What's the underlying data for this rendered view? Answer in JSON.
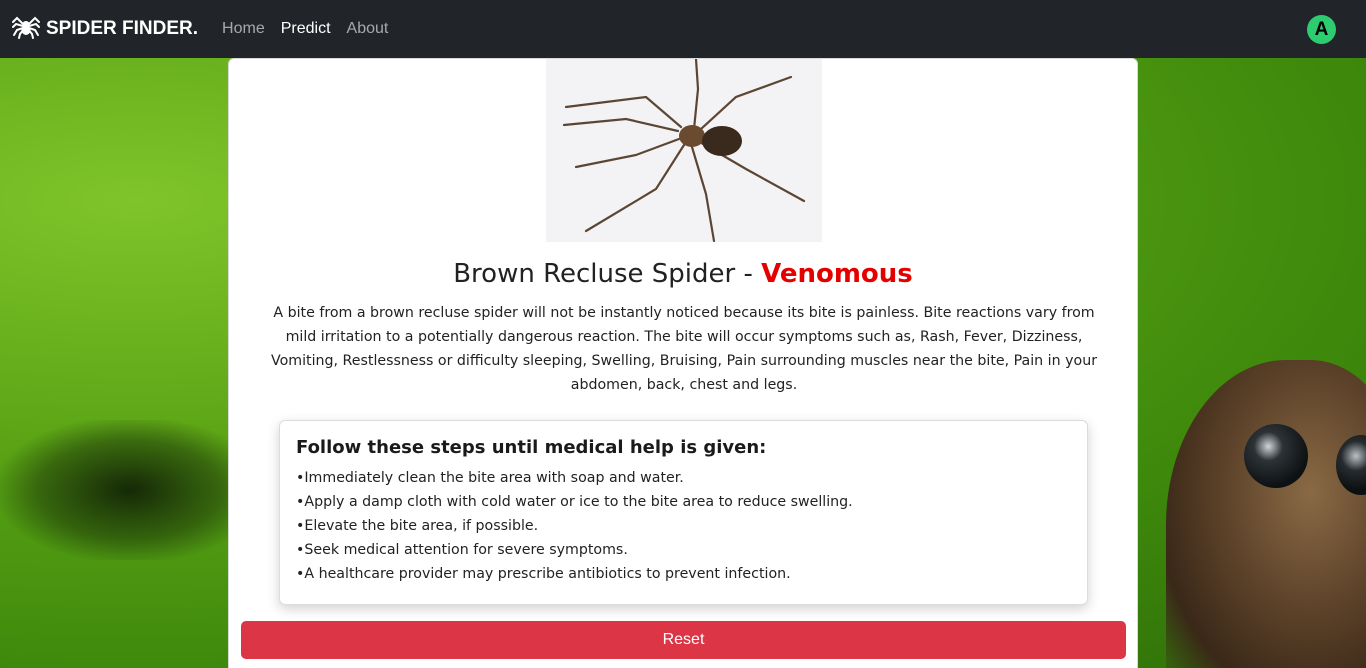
{
  "navbar": {
    "brand": "SPIDER FINDER.",
    "links": [
      "Home",
      "Predict",
      "About"
    ],
    "active": "Predict",
    "avatar_initial": "A"
  },
  "result": {
    "species": "Brown Recluse Spider - ",
    "status": "Venomous",
    "description": "A bite from a brown recluse spider will not be instantly noticed because its bite is painless. Bite reactions vary from mild irritation to a potentially dangerous reaction. The bite will occur symptoms such as, Rash, Fever, Dizziness, Vomiting, Restlessness or difficulty sleeping, Swelling, Bruising, Pain surrounding muscles near the bite, Pain in your abdomen, back, chest and legs."
  },
  "steps": {
    "heading": "Follow these steps until medical help is given:",
    "items": [
      "Immediately clean the bite area with soap and water.",
      "Apply a damp cloth with cold water or ice to the bite area to reduce swelling.",
      "Elevate the bite area, if possible.",
      "Seek medical attention for severe symptoms.",
      "A healthcare provider may prescribe antibiotics to prevent infection."
    ]
  },
  "actions": {
    "reset_label": "Reset"
  },
  "colors": {
    "navbar": "#212529",
    "danger": "#dc3545",
    "venomous": "#e50000",
    "avatar": "#2ecc71"
  }
}
